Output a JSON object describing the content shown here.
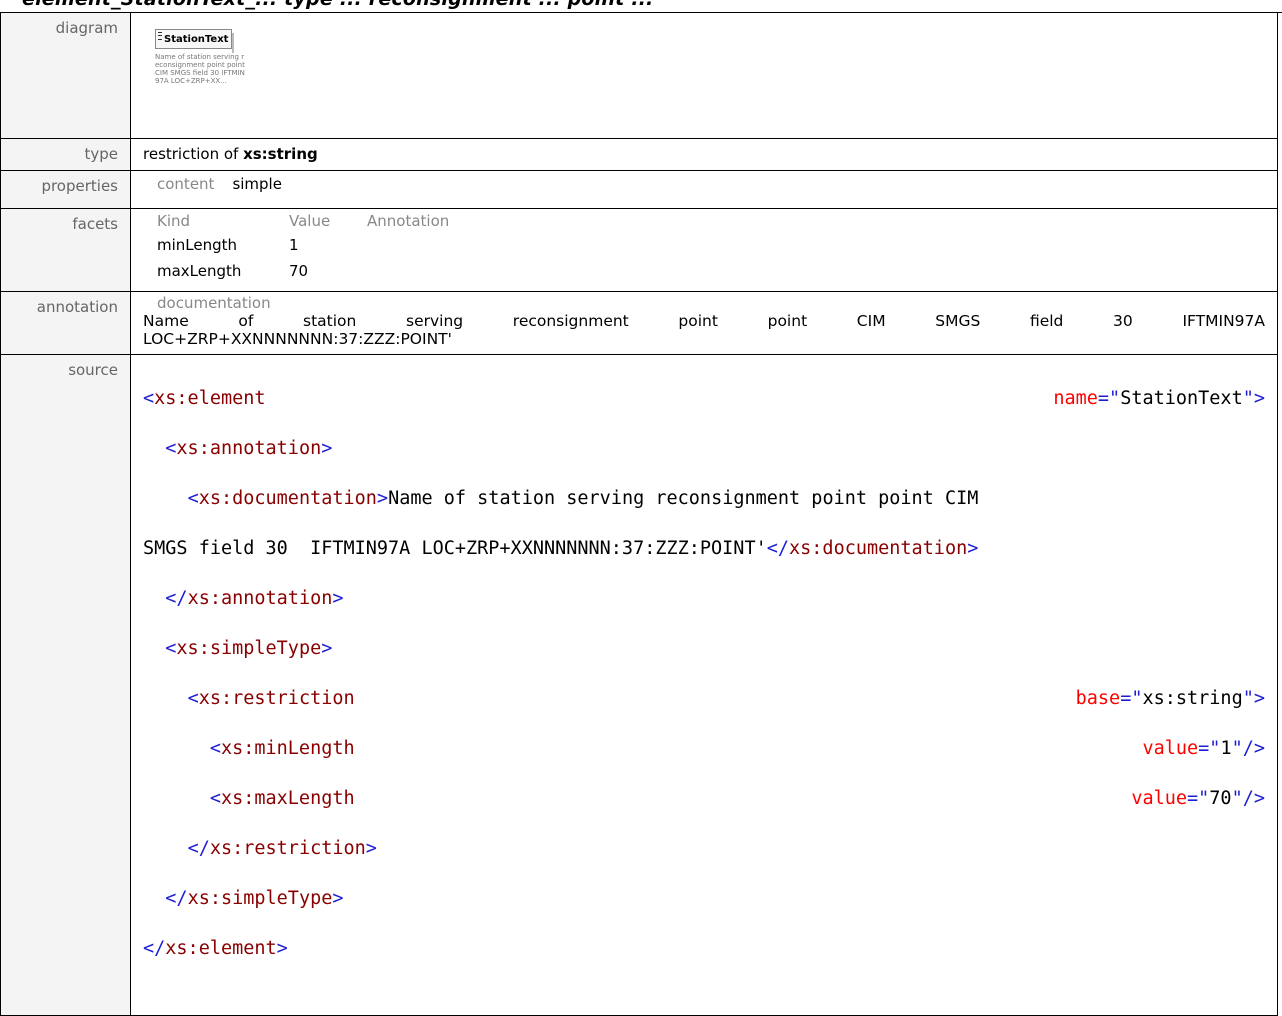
{
  "header": {
    "title": "element_StationText_...  type  ...  reconsignment  ...  point  ..."
  },
  "diagram": {
    "label": "diagram",
    "element_name": "StationText",
    "doc_snippet": "Name of station serving reconsignment point point CIM SMGS field 30 IFTMIN97A LOC+ZRP+XX..."
  },
  "type": {
    "label": "type",
    "prefix": "restriction of ",
    "base": "xs:string"
  },
  "properties": {
    "label": "properties",
    "key": "content",
    "value": "simple"
  },
  "facets": {
    "label": "facets",
    "headers": [
      "Kind",
      "Value",
      "Annotation"
    ],
    "rows": [
      {
        "kind": "minLength",
        "value": "1"
      },
      {
        "kind": "maxLength",
        "value": "70"
      }
    ]
  },
  "annotation": {
    "label": "annotation",
    "key": "documentation",
    "line1": "Name of station serving reconsignment point point CIM SMGS field 30 IFTMIN97A",
    "line2": "LOC+ZRP+XXNNNNNNN:37:ZZZ:POINT'"
  },
  "source": {
    "label": "source",
    "element_open": "xs:element",
    "name_attr": "name",
    "name_val": "StationText",
    "annotation_tag": "xs:annotation",
    "documentation_tag": "xs:documentation",
    "doc_text_1": "Name of station serving reconsignment point point CIM",
    "doc_text_2": "SMGS field 30  IFTMIN97A LOC+ZRP+XXNNNNNNN:37:ZZZ:POINT'",
    "simpletype_tag": "xs:simpleType",
    "restriction_tag": "xs:restriction",
    "base_attr": "base",
    "base_val": "xs:string",
    "minlength_tag": "xs:minLength",
    "maxlength_tag": "xs:maxLength",
    "value_attr": "value",
    "min_val": "1",
    "max_val": "70"
  }
}
